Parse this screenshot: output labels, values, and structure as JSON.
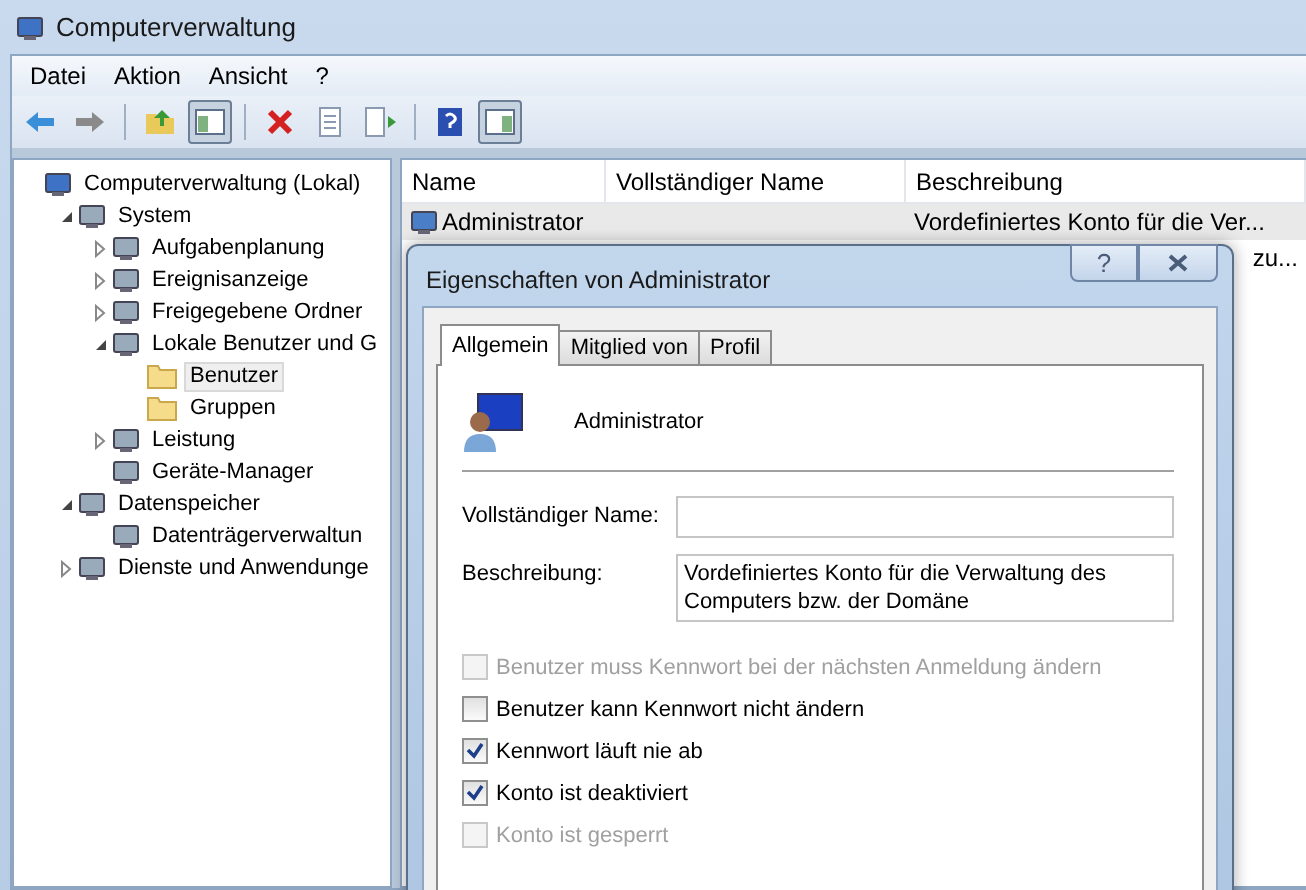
{
  "window": {
    "title": "Computerverwaltung"
  },
  "menu": [
    "Datei",
    "Aktion",
    "Ansicht",
    "?"
  ],
  "toolbar": [
    {
      "kind": "back"
    },
    {
      "kind": "forward"
    },
    {
      "kind": "sep"
    },
    {
      "kind": "up"
    },
    {
      "kind": "tree",
      "pressed": true
    },
    {
      "kind": "sep"
    },
    {
      "kind": "delete"
    },
    {
      "kind": "properties"
    },
    {
      "kind": "export"
    },
    {
      "kind": "sep"
    },
    {
      "kind": "help"
    },
    {
      "kind": "action",
      "pressed": true
    }
  ],
  "tree": [
    {
      "label": "Computerverwaltung (Lokal)",
      "selected": false,
      "children": [
        {
          "label": "System",
          "expanded": true,
          "selected": false,
          "children": [
            {
              "label": "Aufgabenplanung",
              "expanded": false,
              "selected": false
            },
            {
              "label": "Ereignisanzeige",
              "expanded": false,
              "selected": false
            },
            {
              "label": "Freigegebene Ordner",
              "expanded": false,
              "selected": false
            },
            {
              "label": "Lokale Benutzer und G",
              "expanded": true,
              "selected": false,
              "children": [
                {
                  "label": "Benutzer",
                  "selected": true
                },
                {
                  "label": "Gruppen",
                  "selected": false
                }
              ]
            },
            {
              "label": "Leistung",
              "expanded": false,
              "selected": false
            },
            {
              "label": "Geräte-Manager",
              "selected": false
            }
          ]
        },
        {
          "label": "Datenspeicher",
          "expanded": true,
          "selected": false,
          "children": [
            {
              "label": "Datenträgerverwaltun",
              "selected": false
            }
          ]
        },
        {
          "label": "Dienste und Anwendunge",
          "expanded": false,
          "selected": false
        }
      ]
    }
  ],
  "list": {
    "columns": [
      "Name",
      "Vollständiger Name",
      "Beschreibung"
    ],
    "rows": [
      {
        "name": "Administrator",
        "full_name": "",
        "description": "Vordefiniertes Konto für die Ver...",
        "selected": true,
        "clipped": false
      },
      {
        "name": "",
        "full_name": "",
        "description": "zu...",
        "selected": false,
        "clipped": true
      }
    ]
  },
  "dialog": {
    "title": "Eigenschaften von Administrator",
    "help_button": "?",
    "tabs": [
      {
        "label": "Allgemein",
        "selected": true
      },
      {
        "label": "Mitglied von",
        "selected": false
      },
      {
        "label": "Profil",
        "selected": false
      }
    ],
    "user": "Administrator",
    "fields": [
      {
        "label": "Vollständiger Name:"
      },
      {
        "label": "Beschreibung:",
        "value": "Vordefiniertes Konto für die Verwaltung des Computers bzw. der Domäne"
      }
    ],
    "options": [
      {
        "label": "Benutzer muss Kennwort bei der nächsten Anmeldung ändern",
        "checked": false,
        "disabled": true
      },
      {
        "label": "Benutzer kann Kennwort nicht ändern",
        "checked": false,
        "disabled": false
      },
      {
        "label": "Kennwort läuft nie ab",
        "checked": true,
        "disabled": false
      },
      {
        "label": "Konto ist deaktiviert",
        "checked": true,
        "disabled": false
      },
      {
        "label": "Konto ist gesperrt",
        "checked": false,
        "disabled": true
      }
    ]
  }
}
